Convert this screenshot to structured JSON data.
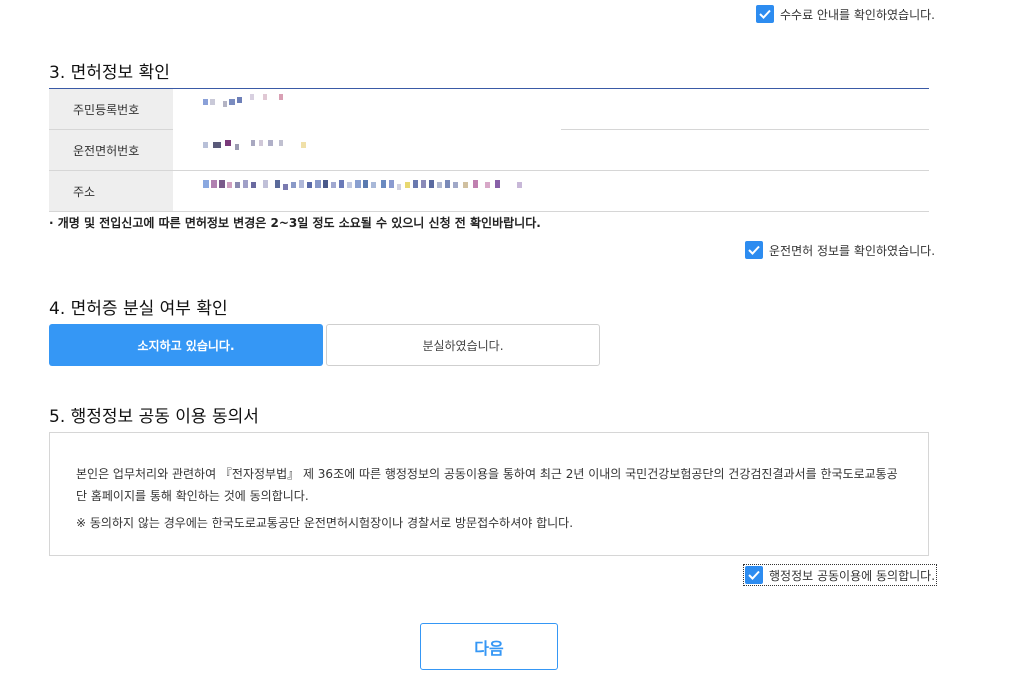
{
  "fee_confirm": {
    "label": "수수료 안내를 확인하였습니다.",
    "checked": true
  },
  "section3": {
    "title": "3. 면허정보 확인",
    "rows": [
      {
        "label": "주민등록번호",
        "value": ""
      },
      {
        "label": "운전면허번호",
        "value": ""
      },
      {
        "label": "주소",
        "value": ""
      }
    ],
    "notice": "· 개명 및 전입신고에 따른 면허정보 변경은 2~3일 정도 소요될 수 있으니 신청 전 확인바랍니다.",
    "confirm": {
      "label": "운전면허 정보를 확인하였습니다.",
      "checked": true
    }
  },
  "section4": {
    "title": "4. 면허증 분실 여부 확인",
    "options": [
      {
        "label": "소지하고 있습니다.",
        "selected": true
      },
      {
        "label": "분실하였습니다.",
        "selected": false
      }
    ]
  },
  "section5": {
    "title": "5. 행정정보 공동 이용 동의서",
    "body": "본인은 업무처리와 관련하여 『전자정부법』 제 36조에 따른 행정정보의 공동이용을 통하여 최근 2년 이내의 국민건강보험공단의 건강검진결과서를 한국도로교통공단 홈페이지를 통해 확인하는 것에 동의합니다.",
    "note": "※ 동의하지 않는 경우에는 한국도로교통공단 운전면허시험장이나 경찰서로 방문접수하셔야 합니다.",
    "agree": {
      "label": "행정정보 공동이용에 동의합니다.",
      "checked": true
    }
  },
  "next_button": {
    "label": "다음"
  },
  "colors": {
    "accent": "#3597f5",
    "checkbox": "#2d8cf0",
    "table_top_border": "#3a5aa6"
  },
  "icons": {
    "checkbox": "check-icon"
  }
}
